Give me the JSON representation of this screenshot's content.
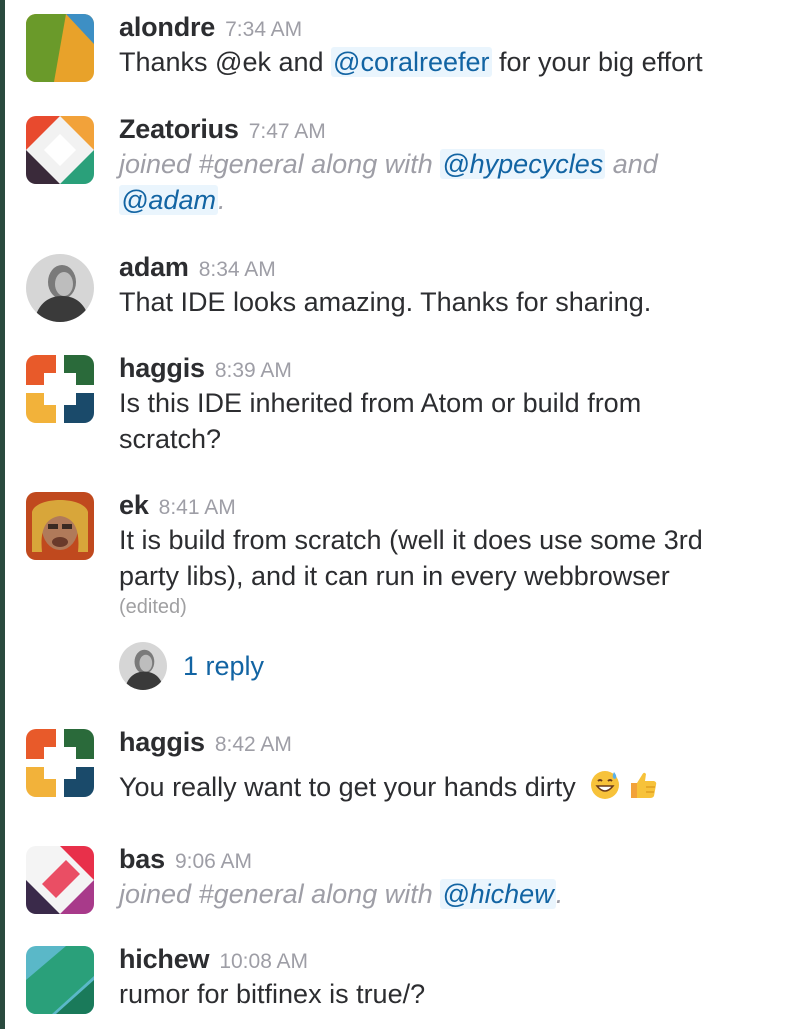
{
  "messages": [
    {
      "user": "alondre",
      "time": "7:34 AM",
      "text_before": "Thanks @ek and ",
      "mention": "@coralreefer",
      "text_after": " for your big effort"
    },
    {
      "user": "Zeatorius",
      "time": "7:47 AM",
      "sys_text": "joined #general along with ",
      "mention1": "@hypecycles",
      "mid": " and",
      "mention2": "@adam",
      "end": "."
    },
    {
      "user": "adam",
      "time": "8:34 AM",
      "text": "That IDE looks amazing. Thanks for sharing."
    },
    {
      "user": "haggis",
      "time": "8:39 AM",
      "line1": "Is this IDE inherited from Atom or build from",
      "line2": "scratch?"
    },
    {
      "user": "ek",
      "time": "8:41 AM",
      "line1": "It is build from scratch (well it does use some 3rd",
      "line2": "party libs), and it can run in every webbrowser",
      "edited": "(edited)",
      "reply": "1 reply"
    },
    {
      "user": "haggis",
      "time": "8:42 AM",
      "text": "You really want to get your hands dirty",
      "emoji": [
        "sweat-smile-emoji",
        "thumbs-up-emoji"
      ]
    },
    {
      "user": "bas",
      "time": "9:06 AM",
      "sys_text": "joined #general along with ",
      "mention": "@hichew",
      "end": "."
    },
    {
      "user": "hichew",
      "time": "10:08 AM",
      "text": "rumor for bitfinex is true/?"
    }
  ],
  "colors": {
    "mention": "#1264a3",
    "mention_bg": "#eaf5fd",
    "timestamp": "#9e9ea6"
  }
}
